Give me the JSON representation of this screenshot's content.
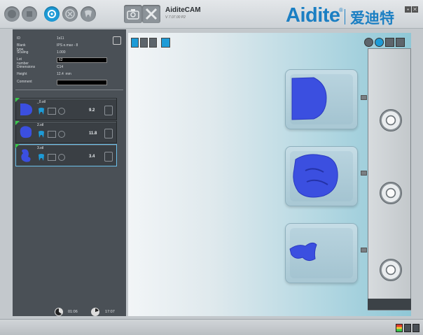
{
  "header": {
    "app_title": "AiditeCAM",
    "app_version": "V 7.07.00 P2",
    "brand_en": "Aidite",
    "brand_reg": "®",
    "brand_cn": "爱迪特"
  },
  "info": {
    "id_label": "ID",
    "id_value": "1s11",
    "blank_type_label": "Blank type",
    "blank_type_value": "IPS e.max - 8",
    "scaling_label": "Scaling",
    "scaling_value": "1.000",
    "lot_label": "Lot number",
    "lot_value": "62",
    "dimensions_label": "Dimensions",
    "dimensions_value": "C14",
    "height_label": "Height",
    "height_value": "12.4",
    "height_unit": "mm",
    "comment_label": "Comment",
    "comment_value": ""
  },
  "jobs": [
    {
      "name": "_0.stl",
      "value": "9.2",
      "selected": false
    },
    {
      "name": "2.stl",
      "value": "11.8",
      "selected": false
    },
    {
      "name": "3.stl",
      "value": "3.4",
      "selected": true
    }
  ],
  "timers": {
    "elapsed": "01:06",
    "remaining": "17:07"
  },
  "colors": {
    "accent": "#1d9bd7",
    "brand": "#1b7fc3",
    "restoration": "#3b4fe0",
    "panel": "#4a5056"
  }
}
